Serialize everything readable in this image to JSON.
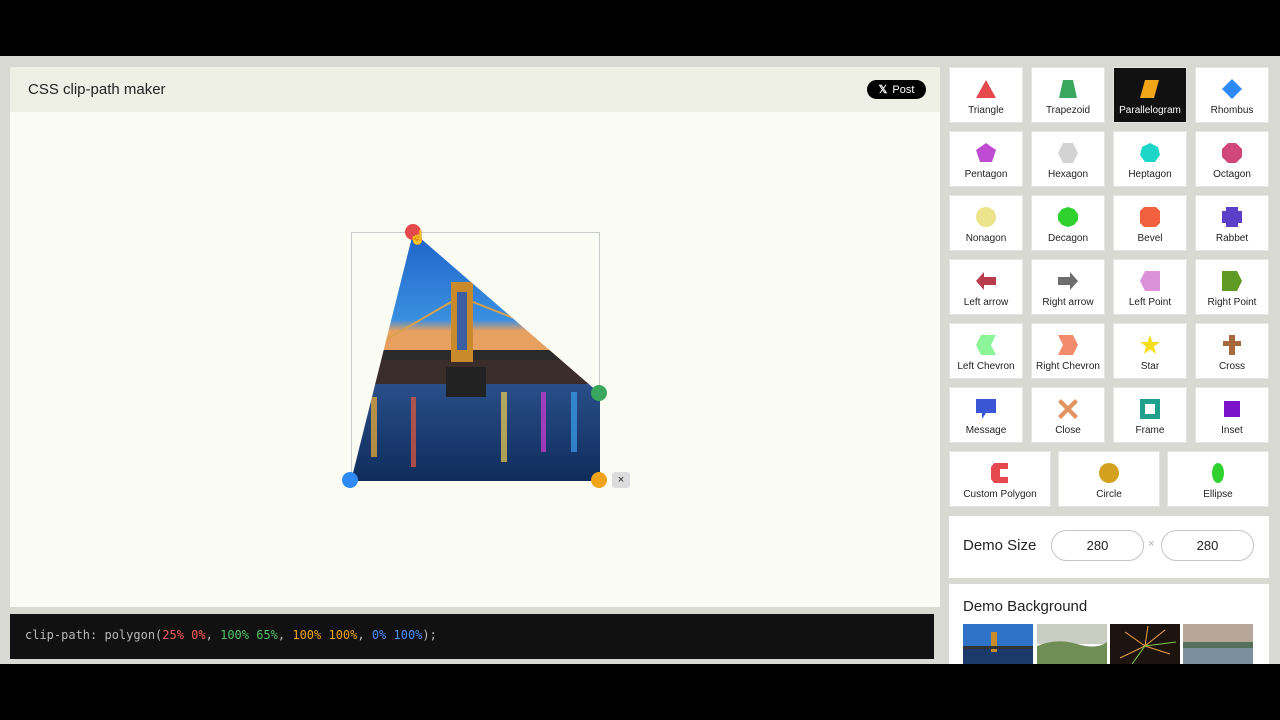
{
  "app": {
    "title": "CSS clip-path maker",
    "post_label": "Post",
    "post_icon": "x-logo-icon"
  },
  "clip_path": {
    "property": "clip-path:",
    "function": "polygon(",
    "points": [
      "25% 0%",
      "100% 65%",
      "100% 100%",
      "0% 100%"
    ],
    "separator": ", ",
    "closing": ");",
    "handle_colors": [
      "#e5484d",
      "#3aa75f",
      "#f0a418",
      "#2f8af5"
    ]
  },
  "editor": {
    "delete_label": "×"
  },
  "shapes": [
    {
      "label": "Triangle",
      "icon": "triangle-icon",
      "color": "#e5484d"
    },
    {
      "label": "Trapezoid",
      "icon": "trapezoid-icon",
      "color": "#3aa75f"
    },
    {
      "label": "Parallelogram",
      "icon": "parallelogram-icon",
      "color": "#f0a418",
      "active": true
    },
    {
      "label": "Rhombus",
      "icon": "rhombus-icon",
      "color": "#2f8af5"
    },
    {
      "label": "Pentagon",
      "icon": "pentagon-icon",
      "color": "#c04bd3"
    },
    {
      "label": "Hexagon",
      "icon": "hexagon-icon",
      "color": "#d3d3d3"
    },
    {
      "label": "Heptagon",
      "icon": "heptagon-icon",
      "color": "#1ed6c7"
    },
    {
      "label": "Octagon",
      "icon": "octagon-icon",
      "color": "#d0487b"
    },
    {
      "label": "Nonagon",
      "icon": "nonagon-icon",
      "color": "#ece38a"
    },
    {
      "label": "Decagon",
      "icon": "decagon-icon",
      "color": "#2fd12f"
    },
    {
      "label": "Bevel",
      "icon": "bevel-icon",
      "color": "#f2613f"
    },
    {
      "label": "Rabbet",
      "icon": "rabbet-icon",
      "color": "#5b3fc9"
    },
    {
      "label": "Left arrow",
      "icon": "left-arrow-icon",
      "color": "#b83b4e"
    },
    {
      "label": "Right arrow",
      "icon": "right-arrow-icon",
      "color": "#6e6e6e"
    },
    {
      "label": "Left Point",
      "icon": "left-point-icon",
      "color": "#dc92d8"
    },
    {
      "label": "Right Point",
      "icon": "right-point-icon",
      "color": "#5f9b24"
    },
    {
      "label": "Left Chevron",
      "icon": "left-chevron-icon",
      "color": "#8cf59a"
    },
    {
      "label": "Right Chevron",
      "icon": "right-chevron-icon",
      "color": "#f28c6c"
    },
    {
      "label": "Star",
      "icon": "star-icon",
      "color": "#f3df1e"
    },
    {
      "label": "Cross",
      "icon": "cross-icon",
      "color": "#a8683b"
    },
    {
      "label": "Message",
      "icon": "message-icon",
      "color": "#3a55d6"
    },
    {
      "label": "Close",
      "icon": "close-icon",
      "color": "#e39261"
    },
    {
      "label": "Frame",
      "icon": "frame-icon",
      "color": "#1fa08c"
    },
    {
      "label": "Inset",
      "icon": "inset-icon",
      "color": "#7b12c9"
    },
    {
      "label": "Custom Polygon",
      "icon": "custom-polygon-icon",
      "color": "#e5484d"
    },
    {
      "label": "Circle",
      "icon": "circle-icon",
      "color": "#d3a11d"
    },
    {
      "label": "Ellipse",
      "icon": "ellipse-icon",
      "color": "#2fd12f"
    }
  ],
  "demo_size": {
    "label": "Demo Size",
    "width": "280",
    "height": "280",
    "separator": "×"
  },
  "demo_background": {
    "label": "Demo Background",
    "thumbnails": [
      "bridge-night-thumbnail",
      "green-hills-thumbnail",
      "fireworks-thumbnail",
      "misty-lake-thumbnail"
    ]
  }
}
